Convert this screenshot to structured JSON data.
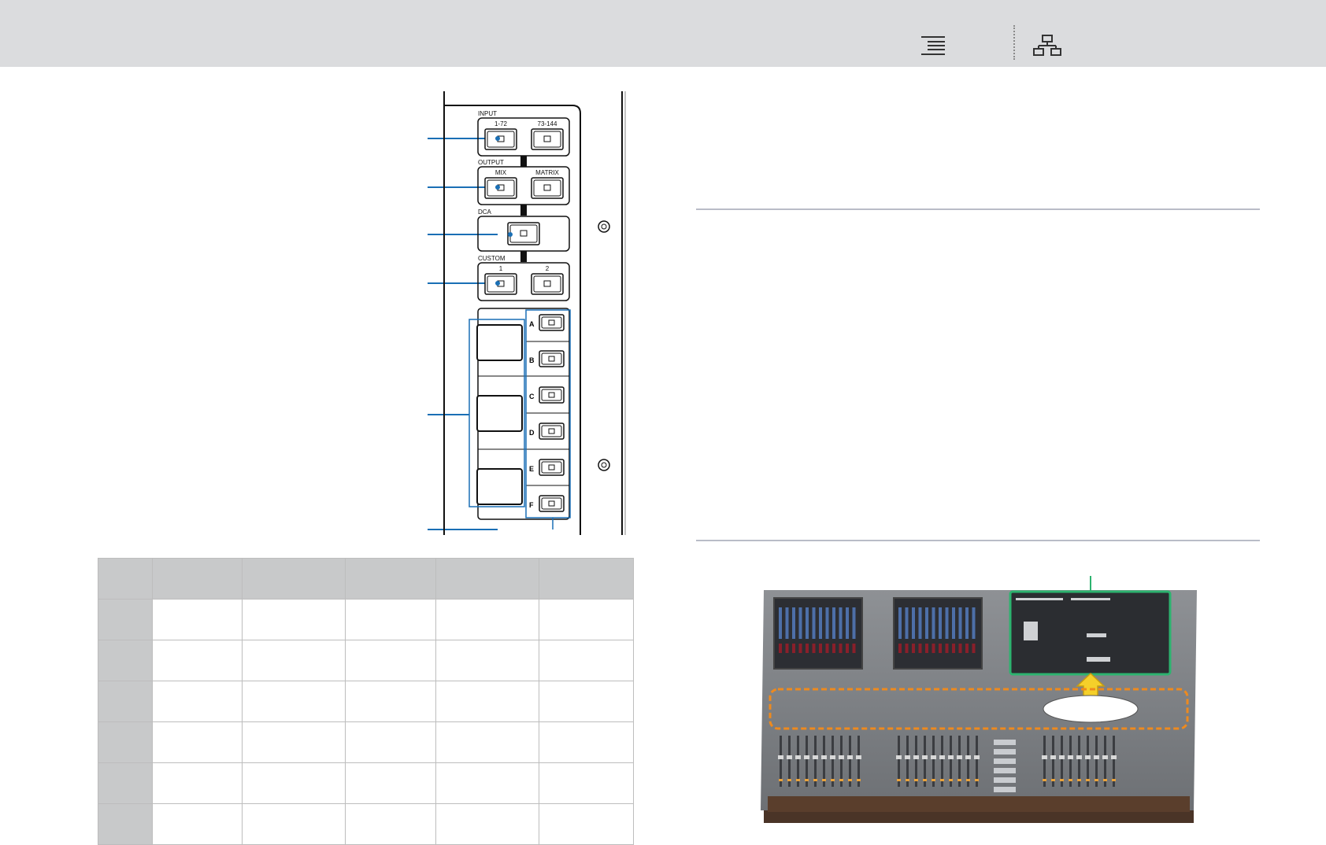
{
  "toolbar": {
    "toc_icon": "table-of-contents-icon",
    "sitemap_icon": "sitemap-icon"
  },
  "panel": {
    "input_group_label": "INPUT",
    "input_buttons": [
      "1-72",
      "73-144"
    ],
    "output_group_label": "OUTPUT",
    "output_buttons": [
      "MIX",
      "MATRIX"
    ],
    "dca_label": "DCA",
    "custom_group_label": "CUSTOM",
    "custom_buttons": [
      "1",
      "2"
    ],
    "bank_letters": [
      "A",
      "B",
      "C",
      "D",
      "E",
      "F"
    ]
  },
  "table": {
    "columns": 6,
    "rows": 6
  },
  "colors": {
    "topbar": "#dbdcde",
    "callout_blue": "#1a6fb5",
    "highlight_green": "#2db36f",
    "highlight_orange": "#ee8a1e",
    "arrow_yellow": "#f5d02a",
    "table_header": "#c8c9ca"
  }
}
